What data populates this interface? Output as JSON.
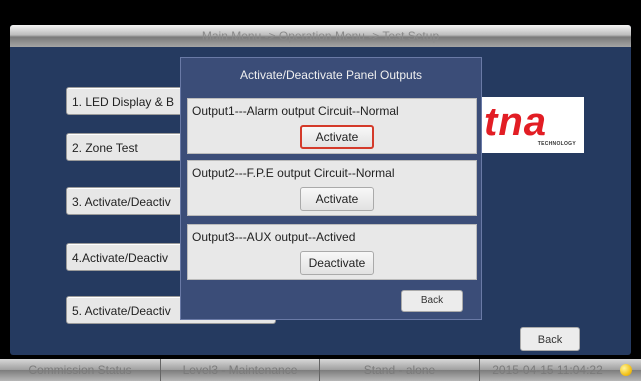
{
  "titlebar": {
    "breadcrumb": "Main Menu -> Operation Menu -> Test Setup"
  },
  "menu": {
    "items": [
      {
        "label": "1. LED Display & B"
      },
      {
        "label": "2. Zone Test"
      },
      {
        "label": "3. Activate/Deactiv"
      },
      {
        "label": "4.Activate/Deactiv"
      },
      {
        "label": "5. Activate/Deactiv"
      }
    ]
  },
  "logo": {
    "text": "tna",
    "subtext": "TECHNOLOGY"
  },
  "back_label": "Back",
  "dialog": {
    "title": "Activate/Deactivate Panel Outputs",
    "outputs": [
      {
        "label": "Output1---Alarm output Circuit--Normal",
        "button": "Activate"
      },
      {
        "label": "Output2---F.P.E output Circuit--Normal",
        "button": "Activate"
      },
      {
        "label": "Output3---AUX output--Actived",
        "button": "Deactivate"
      }
    ],
    "back_label": "Back"
  },
  "status": {
    "mode": "Commission Status",
    "level": "Level3 - Maintenance",
    "network": "Stand - alone",
    "datetime": "2015-04-15 11:04:22",
    "indicator_color": "#f3c21b"
  }
}
